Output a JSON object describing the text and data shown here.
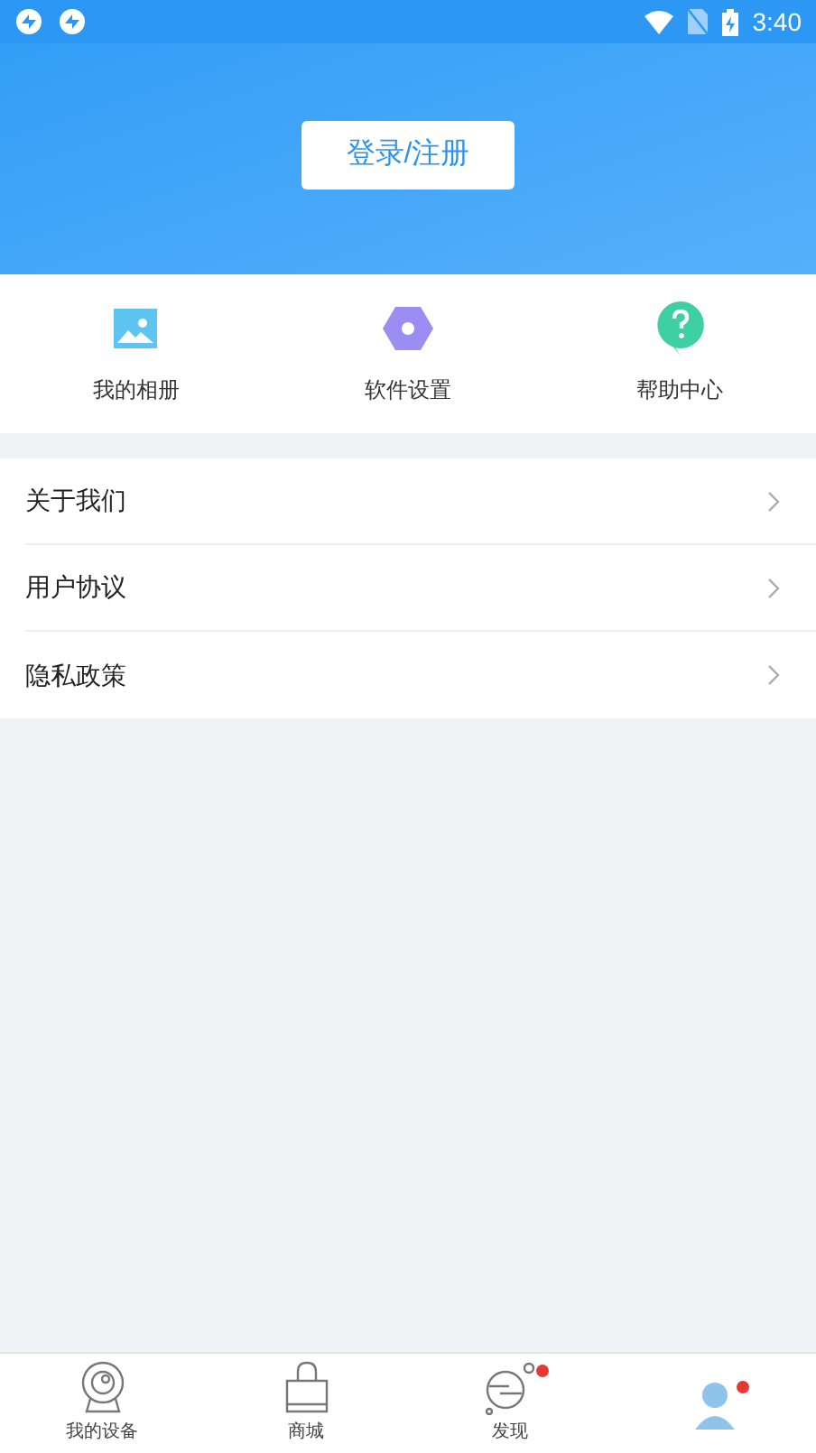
{
  "status_bar": {
    "time": "3:40"
  },
  "header": {
    "login_button": "登录/注册"
  },
  "shortcuts": [
    {
      "kind": "album",
      "label": "我的相册"
    },
    {
      "kind": "settings",
      "label": "软件设置"
    },
    {
      "kind": "help",
      "label": "帮助中心"
    }
  ],
  "menu": [
    "关于我们",
    "用户协议",
    "隐私政策"
  ],
  "tabs": [
    {
      "kind": "device",
      "label": "我的设备",
      "dot": false
    },
    {
      "kind": "shop",
      "label": "商城",
      "dot": false
    },
    {
      "kind": "discover",
      "label": "发现",
      "dot": true
    },
    {
      "kind": "me",
      "dot": true
    }
  ]
}
